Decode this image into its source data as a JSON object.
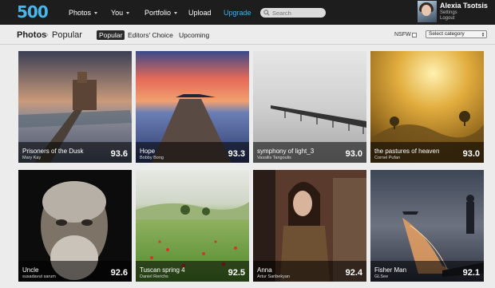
{
  "brand": {
    "logo_text": "500",
    "accent": "#49b6e8"
  },
  "nav": {
    "items": [
      {
        "label": "Photos",
        "has_menu": true
      },
      {
        "label": "You",
        "has_menu": true
      },
      {
        "label": "Portfolio",
        "has_menu": true
      },
      {
        "label": "Upload",
        "has_menu": false
      },
      {
        "label": "Upgrade",
        "has_menu": false
      }
    ],
    "search_placeholder": "Search"
  },
  "user": {
    "name": "Alexia Tsotsis",
    "settings_label": "Settings",
    "logout_label": "Logout"
  },
  "subheader": {
    "breadcrumb_root": "Photos",
    "breadcrumb_current": "Popular",
    "tabs": [
      {
        "label": "Popular",
        "active": true
      },
      {
        "label": "Editors' Choice",
        "active": false
      },
      {
        "label": "Upcoming",
        "active": false
      }
    ],
    "nsfw_label": "NSFW",
    "category_select": "Select category"
  },
  "photos": [
    {
      "title": "Prisoners of the Dusk",
      "author": "Mary Kay",
      "score": "93.6"
    },
    {
      "title": "Hope",
      "author": "Bobby Bong",
      "score": "93.3"
    },
    {
      "title": "symphony of light_3",
      "author": "Vassilis Tangoulis",
      "score": "93.0"
    },
    {
      "title": "the pastures of heaven",
      "author": "Cornel Pufan",
      "score": "93.0"
    },
    {
      "title": "Uncle",
      "author": "susadavut sarum",
      "score": "92.6"
    },
    {
      "title": "Tuscan spring 4",
      "author": "Daniel Rerichs",
      "score": "92.5"
    },
    {
      "title": "Anna",
      "author": "Artur Saribekyan",
      "score": "92.4"
    },
    {
      "title": "Fisher Man",
      "author": "GLSee",
      "score": "92.1"
    }
  ]
}
